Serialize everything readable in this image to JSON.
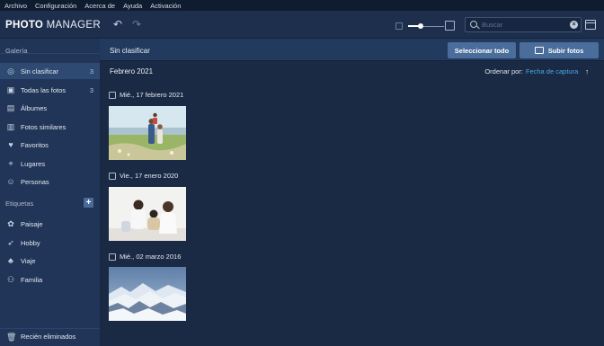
{
  "menu": [
    "Archivo",
    "Configuración",
    "Acerca de",
    "Ayuda",
    "Activación"
  ],
  "toolbar": {
    "logo_bold": "PHOTO",
    "logo_light": " MANAGER",
    "undo_icon": "undo-icon",
    "redo_icon": "redo-icon",
    "zoom_level": 0.35,
    "search_placeholder": "Buscar"
  },
  "sidebar": {
    "gallery_label": "Galería",
    "items": [
      {
        "label": "Sin clasificar",
        "count": "3",
        "icon": "unsorted-icon"
      },
      {
        "label": "Todas las fotos",
        "count": "3",
        "icon": "photos-icon"
      },
      {
        "label": "Álbumes",
        "count": "",
        "icon": "albums-icon"
      },
      {
        "label": "Fotos similares",
        "count": "",
        "icon": "similar-photos-icon"
      },
      {
        "label": "Favoritos",
        "count": "",
        "icon": "heart-icon"
      },
      {
        "label": "Lugares",
        "count": "",
        "icon": "map-pin-icon"
      },
      {
        "label": "Personas",
        "count": "",
        "icon": "person-icon"
      }
    ],
    "tags_label": "Etiquetas",
    "tags": [
      {
        "label": "Paisaje",
        "icon": "landscape-icon"
      },
      {
        "label": "Hobby",
        "icon": "rocket-icon"
      },
      {
        "label": "Viaje",
        "icon": "palm-tree-icon"
      },
      {
        "label": "Familia",
        "icon": "family-icon"
      }
    ],
    "trash_label": "Recién eliminados"
  },
  "main": {
    "title": "Sin clasificar",
    "select_all": "Seleccionar todo",
    "upload": "Subir fotos",
    "month": "Febrero 2021",
    "sort_label": "Ordenar por:",
    "sort_value": "Fecha de captura",
    "groups": [
      {
        "date": "Mié., 17 febrero 2021"
      },
      {
        "date": "Vie., 17 enero 2020"
      },
      {
        "date": "Mié., 02 marzo 2016"
      }
    ]
  },
  "colors": {
    "accent": "#4ea7e6",
    "sidebar_bg": "#203557",
    "active_bg": "#2e4a73",
    "button_bg": "#4b6d9b"
  }
}
